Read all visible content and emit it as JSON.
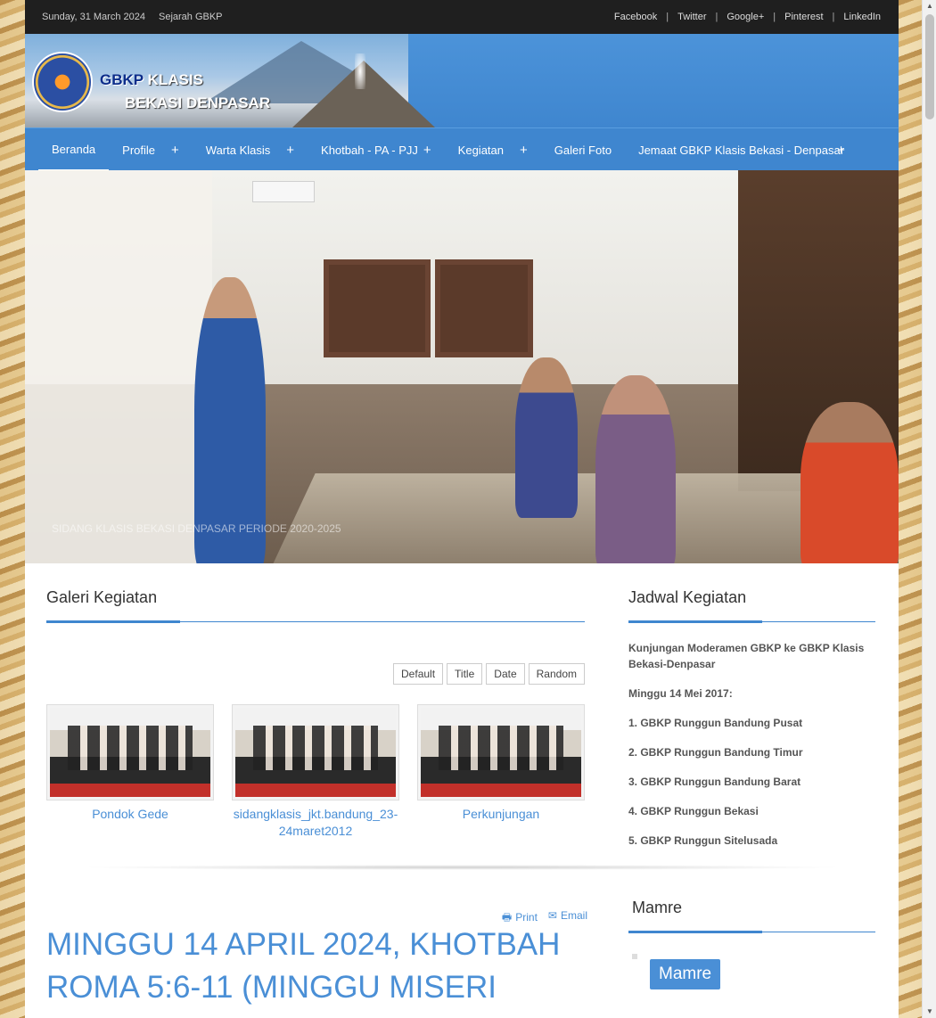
{
  "topbar": {
    "date": "Sunday, 31 March 2024",
    "history_link": "Sejarah GBKP",
    "social": [
      "Facebook",
      "Twitter",
      "Google+",
      "Pinterest",
      "LinkedIn"
    ]
  },
  "logo": {
    "text_line1a": "GBKP",
    "text_line1b": "KLASIS",
    "text_line2": "BEKASI DENPASAR"
  },
  "nav": {
    "items": [
      {
        "label": "Beranda",
        "has_sub": false,
        "active": true
      },
      {
        "label": "Profile",
        "has_sub": true
      },
      {
        "label": "Warta Klasis",
        "has_sub": true
      },
      {
        "label": "Khotbah - PA - PJJ",
        "has_sub": true
      },
      {
        "label": "Kegiatan",
        "has_sub": true
      },
      {
        "label": "Galeri Foto",
        "has_sub": false
      },
      {
        "label": "Jemaat GBKP Klasis Bekasi - Denpasar",
        "has_sub": true
      }
    ]
  },
  "slider": {
    "caption": "SIDANG KLASIS BEKASI DENPASAR PERIODE 2020-2025"
  },
  "gallery": {
    "title": "Galeri Kegiatan",
    "sort_buttons": [
      "Default",
      "Title",
      "Date",
      "Random"
    ],
    "items": [
      {
        "title": "Pondok Gede"
      },
      {
        "title": "sidangklasis_jkt.bandung_23-24maret2012"
      },
      {
        "title": "Perkunjungan"
      }
    ]
  },
  "schedule": {
    "title": "Jadwal Kegiatan",
    "heading": "Kunjungan Moderamen GBKP ke GBKP Klasis Bekasi-Denpasar",
    "date": "Minggu 14 Mei 2017:",
    "items": [
      "1. GBKP Runggun Bandung Pusat",
      "2. GBKP Runggun Bandung Timur",
      "3. GBKP Runggun Bandung Barat",
      "4. GBKP Runggun Bekasi",
      "5. GBKP Runggun Sitelusada"
    ]
  },
  "article": {
    "print_label": "Print",
    "email_label": "Email",
    "title": "MINGGU 14 APRIL 2024, KHOTBAH ROMA 5:6-11 (MINGGU MISERI"
  },
  "mamre": {
    "title": "Mamre",
    "button_label": "Mamre"
  },
  "colors": {
    "accent": "#3f86cf",
    "link": "#4a8fd6",
    "topbar": "#1f1f1f"
  }
}
